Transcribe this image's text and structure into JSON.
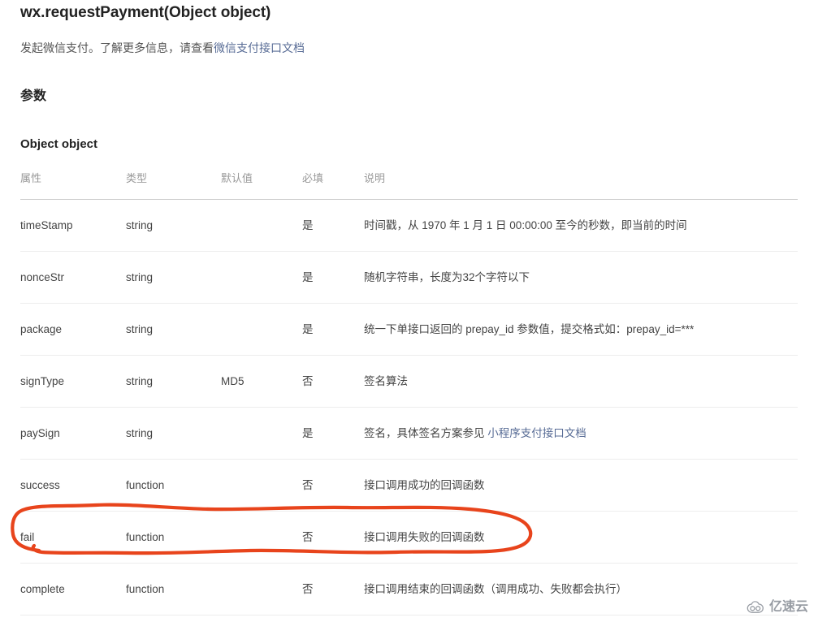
{
  "doc": {
    "title": "wx.requestPayment(Object object)",
    "intro_before": "发起微信支付。了解更多信息，请查看",
    "intro_link": "微信支付接口文档",
    "section_heading": "参数",
    "sub_heading": "Object object"
  },
  "table": {
    "columns": [
      "属性",
      "类型",
      "默认值",
      "必填",
      "说明"
    ],
    "rows": [
      {
        "attr": "timeStamp",
        "type": "string",
        "default": "",
        "required": "是",
        "desc": "时间戳，从 1970 年 1 月 1 日 00:00:00 至今的秒数，即当前的时间",
        "desc_link": ""
      },
      {
        "attr": "nonceStr",
        "type": "string",
        "default": "",
        "required": "是",
        "desc": "随机字符串，长度为32个字符以下",
        "desc_link": ""
      },
      {
        "attr": "package",
        "type": "string",
        "default": "",
        "required": "是",
        "desc": "统一下单接口返回的 prepay_id 参数值，提交格式如：prepay_id=***",
        "desc_link": ""
      },
      {
        "attr": "signType",
        "type": "string",
        "default": "MD5",
        "required": "否",
        "desc": "签名算法",
        "desc_link": ""
      },
      {
        "attr": "paySign",
        "type": "string",
        "default": "",
        "required": "是",
        "desc": "签名，具体签名方案参见 ",
        "desc_link": "小程序支付接口文档"
      },
      {
        "attr": "success",
        "type": "function",
        "default": "",
        "required": "否",
        "desc": "接口调用成功的回调函数",
        "desc_link": ""
      },
      {
        "attr": "fail",
        "type": "function",
        "default": "",
        "required": "否",
        "desc": "接口调用失败的回调函数",
        "desc_link": ""
      },
      {
        "attr": "complete",
        "type": "function",
        "default": "",
        "required": "否",
        "desc": "接口调用结束的回调函数（调用成功、失败都会执行）",
        "desc_link": ""
      }
    ]
  },
  "annotation": {
    "target_row": "fail",
    "color": "#e8441c",
    "shape": "hand-drawn-ellipse"
  },
  "watermark": {
    "text": "亿速云",
    "color": "#8f949c"
  },
  "colors": {
    "link": "#576b95",
    "text": "#444444",
    "heading": "#222222",
    "table_header": "#999999",
    "row_divider": "#ededed",
    "header_divider": "#c9c9c9",
    "annotation": "#e8441c"
  }
}
